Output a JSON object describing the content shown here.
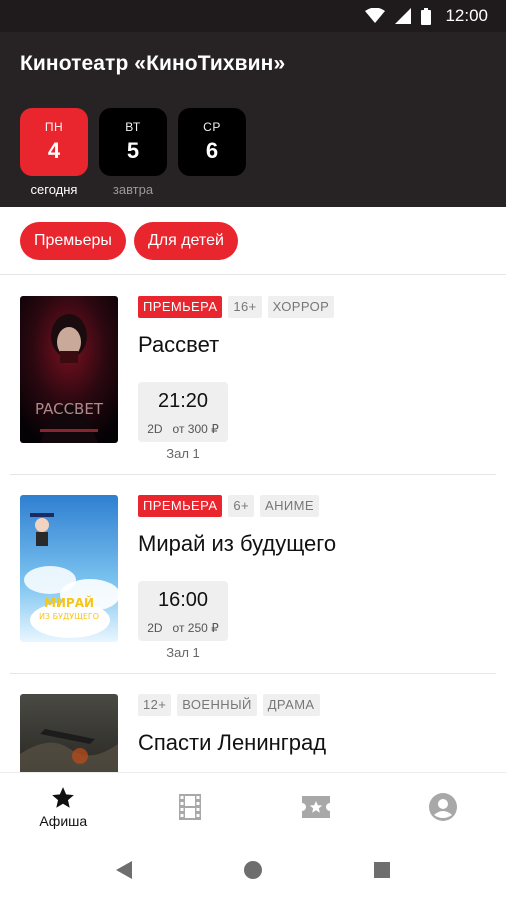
{
  "status_bar": {
    "time": "12:00"
  },
  "app": {
    "title": "Кинотеатр «КиноТихвин»"
  },
  "days": [
    {
      "name": "ПН",
      "number": "4",
      "note": "сегодня",
      "active": true
    },
    {
      "name": "ВТ",
      "number": "5",
      "note": "завтра",
      "active": false
    },
    {
      "name": "СР",
      "number": "6",
      "note": "",
      "active": false
    }
  ],
  "filters": [
    "Премьеры",
    "Для детей"
  ],
  "movies": [
    {
      "tags": {
        "premiere": "ПРЕМЬЕРА",
        "age": "16+",
        "genres": [
          "ХОРРОР"
        ]
      },
      "title": "Рассвет",
      "session": {
        "time": "21:20",
        "format": "2D",
        "price": "от 300 ₽",
        "hall": "Зал 1"
      }
    },
    {
      "tags": {
        "premiere": "ПРЕМЬЕРА",
        "age": "6+",
        "genres": [
          "АНИМЕ"
        ]
      },
      "title": "Мирай из будущего",
      "session": {
        "time": "16:00",
        "format": "2D",
        "price": "от 250 ₽",
        "hall": "Зал 1"
      }
    },
    {
      "tags": {
        "age": "12+",
        "genres": [
          "ВОЕННЫЙ",
          "ДРАМА"
        ]
      },
      "title": "Спасти Ленинград"
    }
  ],
  "bottom_nav": {
    "afisha_label": "Афиша"
  },
  "colors": {
    "accent": "#e9252e",
    "header_bg": "#272223",
    "status_bg": "#1f1b1c"
  },
  "icons": [
    "wifi-icon",
    "signal-icon",
    "battery-icon",
    "star-icon",
    "film-icon",
    "ticket-icon",
    "account-icon",
    "back-icon",
    "home-icon",
    "recents-icon"
  ]
}
